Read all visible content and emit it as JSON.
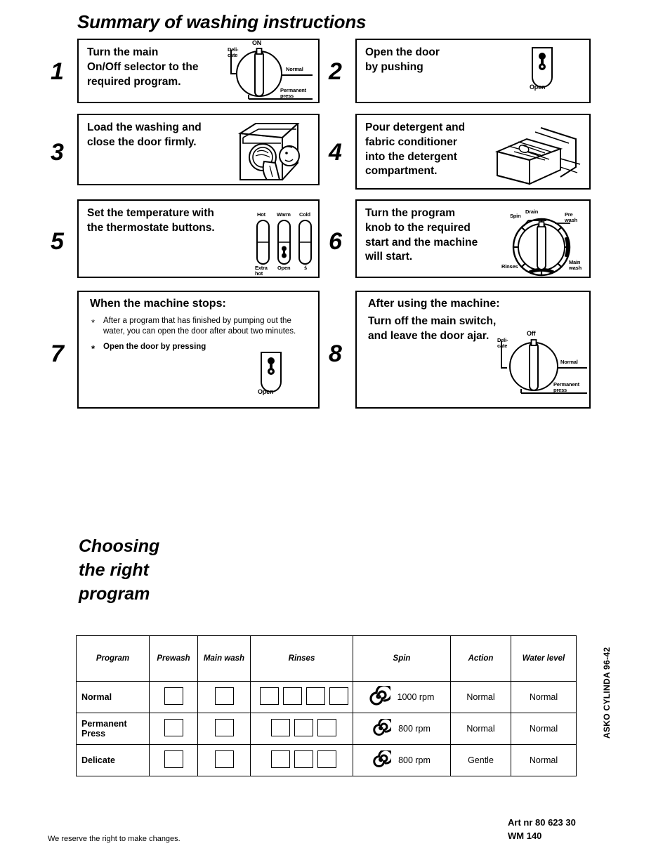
{
  "page": {
    "title": "Summary of washing instructions",
    "section_title": "Choosing\nthe right\nprogram"
  },
  "steps": [
    {
      "number": "1",
      "text": "Turn the main\nOn/Off selector to the\nrequired program.",
      "illustration": "selector-dial",
      "dial_labels": {
        "top": "ON",
        "left": "Deli-\ncate",
        "right": "Normal",
        "bottom": "Permanent\npress"
      }
    },
    {
      "number": "2",
      "text": "Open the door\nby pushing",
      "illustration": "door-open-button",
      "button_label": "Open"
    },
    {
      "number": "3",
      "text": "Load the washing and\nclose the door firmly.",
      "illustration": "washing-machine-loading"
    },
    {
      "number": "4",
      "text": "Pour detergent and\nfabric conditioner\ninto the detergent\ncompartment.",
      "illustration": "detergent-drawer"
    },
    {
      "number": "5",
      "text": "Set the temperature with\nthe thermostate buttons.",
      "illustration": "thermostat-buttons",
      "button_labels_top": [
        "Hot",
        "Warm",
        "Cold"
      ],
      "button_labels_bottom": [
        "Extra\nhot",
        "Open",
        "š"
      ]
    },
    {
      "number": "6",
      "text": "Turn the program\nknob to the required\nstart and the machine\nwill start.",
      "illustration": "program-knob",
      "knob_labels": [
        "Spin",
        "Drain",
        "Pre\nwash",
        "Main\nwash",
        "Rinses"
      ]
    },
    {
      "number": "7",
      "heading": "When the machine stops:",
      "bullets": [
        {
          "text": "After a program that has finished by pumping out the water, you can open the door after about two minutes.",
          "bold": false
        },
        {
          "text": "Open the door by pressing",
          "bold": true
        }
      ],
      "illustration": "door-open-button",
      "button_label": "Open"
    },
    {
      "number": "8",
      "heading": "After using the machine:",
      "text": "Turn off the main switch,\nand leave the door ajar.",
      "illustration": "selector-dial-off",
      "dial_labels": {
        "top": "Off",
        "left": "Deli-\ncate",
        "right": "Normal",
        "bottom": "Permanent\npress"
      }
    }
  ],
  "table": {
    "headers": [
      "Program",
      "Prewash",
      "Main wash",
      "Rinses",
      "Spin",
      "Action",
      "Water level"
    ],
    "rows": [
      {
        "program": "Normal",
        "prewash_boxes": 1,
        "mainwash_boxes": 1,
        "rinse_boxes": 4,
        "spin": "1000 rpm",
        "action": "Normal",
        "water_level": "Normal"
      },
      {
        "program": "Permanent\nPress",
        "prewash_boxes": 1,
        "mainwash_boxes": 1,
        "rinse_boxes": 3,
        "spin": "800 rpm",
        "action": "Normal",
        "water_level": "Normal"
      },
      {
        "program": "Delicate",
        "prewash_boxes": 1,
        "mainwash_boxes": 1,
        "rinse_boxes": 3,
        "spin": "800 rpm",
        "action": "Gentle",
        "water_level": "Normal"
      }
    ]
  },
  "footer": {
    "disclaimer": "We reserve the right to make changes.",
    "art_number": "Art nr 80 623 30",
    "model": "WM 140",
    "vertical_code": "ASKO CYLINDA 96-42"
  }
}
